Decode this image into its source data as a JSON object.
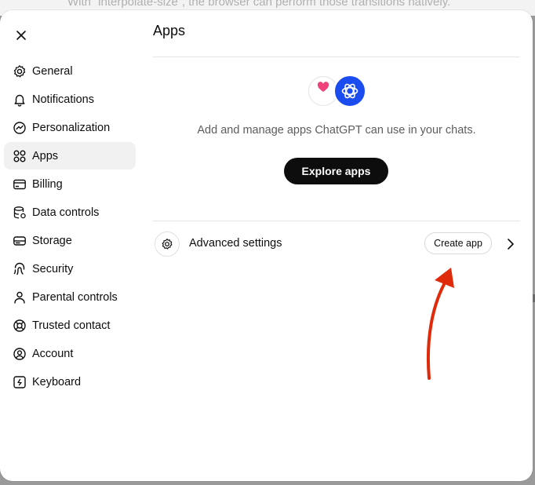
{
  "background": {
    "text": "With `interpolate-size`, the browser can perform those transitions natively."
  },
  "sidebar": {
    "items": [
      {
        "label": "General",
        "icon": "gear-icon"
      },
      {
        "label": "Notifications",
        "icon": "bell-icon"
      },
      {
        "label": "Personalization",
        "icon": "personalization-icon"
      },
      {
        "label": "Apps",
        "icon": "apps-grid-icon",
        "active": true
      },
      {
        "label": "Billing",
        "icon": "credit-card-icon"
      },
      {
        "label": "Data controls",
        "icon": "database-icon"
      },
      {
        "label": "Storage",
        "icon": "storage-icon"
      },
      {
        "label": "Security",
        "icon": "fingerprint-icon"
      },
      {
        "label": "Parental controls",
        "icon": "person-icon"
      },
      {
        "label": "Trusted contact",
        "icon": "lifebuoy-icon"
      },
      {
        "label": "Account",
        "icon": "account-circle-icon"
      },
      {
        "label": "Keyboard",
        "icon": "keyboard-icon"
      }
    ]
  },
  "main": {
    "title": "Apps",
    "hero_text": "Add and manage apps ChatGPT can use in your chats.",
    "explore_label": "Explore apps",
    "advanced_label": "Advanced settings",
    "create_app_label": "Create app"
  },
  "colors": {
    "accent_blue": "#1a4cf0",
    "heart_pink": "#f0427a",
    "annotation_arrow": "#e02a0c",
    "button_dark": "#0d0d0d"
  }
}
